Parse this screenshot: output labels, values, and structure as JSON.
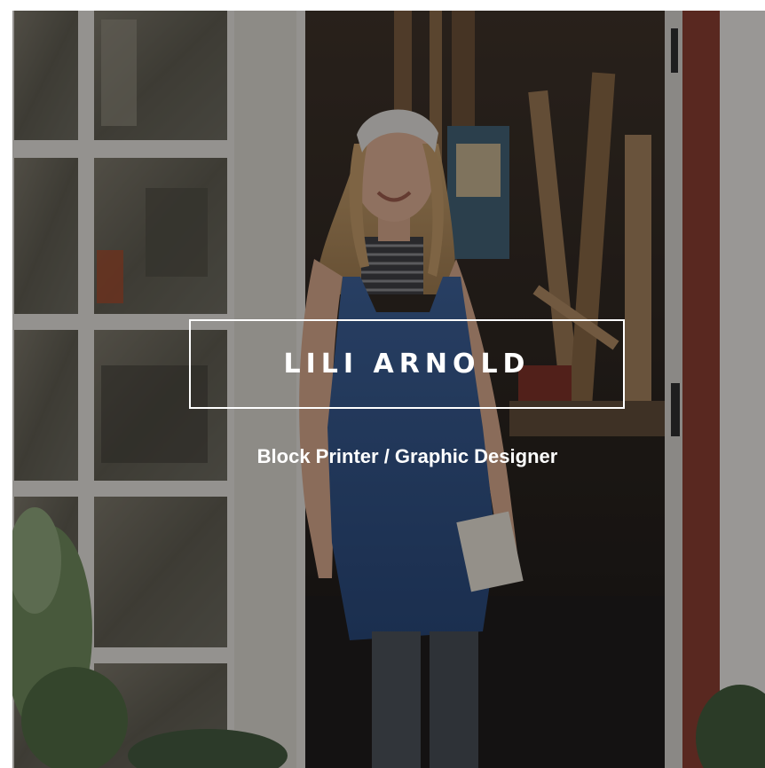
{
  "hero": {
    "name": "LILI ARNOLD",
    "tagline": "Block Printer / Graphic Designer"
  },
  "colors": {
    "overlay": "#0a0a0c",
    "text": "#ffffff",
    "door_frame": "#e9e6df",
    "apron": "#2c4f86",
    "door_trim": "#8a3b2c"
  }
}
